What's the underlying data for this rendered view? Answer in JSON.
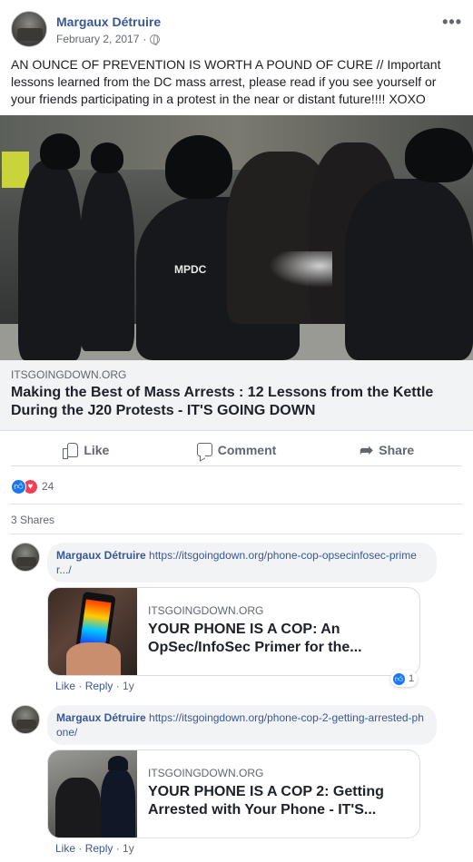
{
  "post": {
    "author": "Margaux Détruire",
    "date": "February 2, 2017",
    "date_separator": "·",
    "privacy_icon": "globe-icon",
    "more_icon": "more-options-icon",
    "text": "AN OUNCE OF PREVENTION IS WORTH A POUND OF CURE // Important lessons learned from the DC mass arrest, please read if you see yourself or your friends participating in a protest in the near or distant future!!!! XOXO"
  },
  "link_preview": {
    "image_badge": "MPDC",
    "domain": "ITSGOINGDOWN.ORG",
    "title": "Making the Best of Mass Arrests : 12 Lessons from the Kettle During the J20 Protests - IT'S GOING DOWN"
  },
  "actions": {
    "like": "Like",
    "comment": "Comment",
    "share": "Share"
  },
  "reactions": {
    "count": "24",
    "types": [
      "like",
      "love"
    ]
  },
  "shares": "3 Shares",
  "comments": [
    {
      "author": "Margaux Détruire",
      "link_text": "https://itsgoingdown.org/phone-cop-opsecinfosec-primer.../",
      "card_domain": "ITSGOINGDOWN.ORG",
      "card_title": "YOUR PHONE IS A COP: An OpSec/InfoSec Primer for the...",
      "like": "Like",
      "reply": "Reply",
      "age": "1y",
      "reaction_count": "1"
    },
    {
      "author": "Margaux Détruire",
      "link_text": "https://itsgoingdown.org/phone-cop-2-getting-arrested-phone/",
      "card_domain": "ITSGOINGDOWN.ORG",
      "card_title": "YOUR PHONE IS A COP 2: Getting Arrested with Your Phone - IT'S...",
      "like": "Like",
      "reply": "Reply",
      "age": "1y"
    }
  ],
  "colors": {
    "link_blue": "#385898",
    "meta_gray": "#606770",
    "like_blue": "#1877f2",
    "love_red": "#f33e58",
    "preview_bg": "#f2f3f5"
  }
}
